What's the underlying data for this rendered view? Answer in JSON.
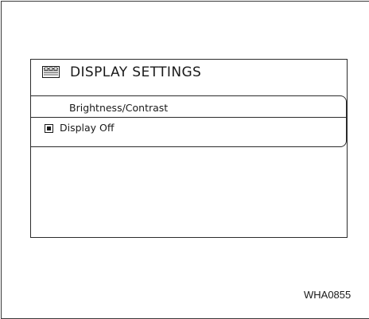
{
  "screen": {
    "title": "DISPLAY SETTINGS",
    "title_icon": "display-screen-icon",
    "menu_items": [
      {
        "label": "Brightness/Contrast"
      },
      {
        "label": "Display Off",
        "indicator": "checked-box-icon",
        "checked": true
      }
    ]
  },
  "figure_code": "WHA0855"
}
